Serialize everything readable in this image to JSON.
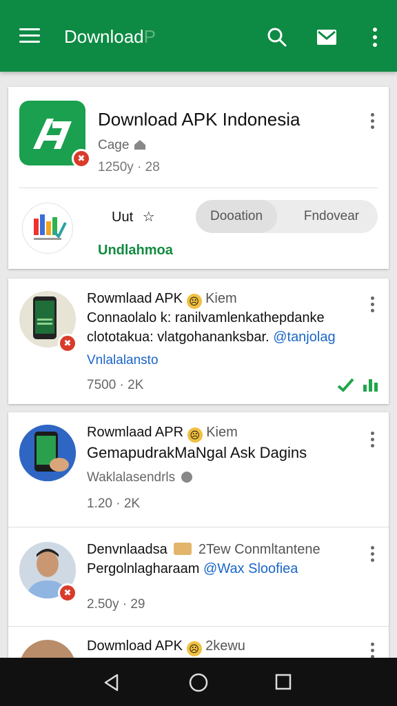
{
  "appbar": {
    "title": "Download",
    "title_faded": "P",
    "icons": [
      "menu-icon",
      "search-icon",
      "mail-icon",
      "overflow-icon"
    ],
    "color": "#0d8a43"
  },
  "app_card": {
    "title": "Download APK Indonesia",
    "subtitle": "Cage",
    "meta": "1250y · 28",
    "action_label": "Uut",
    "link": "Undlahmoa",
    "segments": [
      "Dooation",
      "Fndovear"
    ]
  },
  "posts": [
    {
      "title": "Rowmlaad APK",
      "title_suffix": "Kiem",
      "body_line1": "Connaolalo k: ranilvamlenkathepdanke",
      "body_line2": "clototakua: vlatgohananksbar.",
      "body_tag": "@tanjolag",
      "link": "Vnlalalansto",
      "meta": "7500 · 2K"
    },
    {
      "title": "Rowmlaad APR",
      "title_suffix": "Kiem",
      "body_line1": "GemapudrakMaNgal Ask Dagins",
      "secondary": "Waklalasendrls",
      "meta": "1.20 · 2K"
    },
    {
      "title": "Denvnlaadsa",
      "title_suffix": "2Tew Conmltantene",
      "body_line1": "Pergolnlagharaam",
      "body_tag": "@Wax Sloofiea",
      "meta": "2.50y · 29"
    },
    {
      "title": "Dowmload APK",
      "title_suffix": "2kewu"
    }
  ],
  "colors": {
    "accent": "#0d8a43",
    "link": "#1b66c9",
    "badge": "#d93b2b"
  },
  "navbar": {
    "icons": [
      "back-icon",
      "home-icon",
      "recents-icon"
    ]
  }
}
